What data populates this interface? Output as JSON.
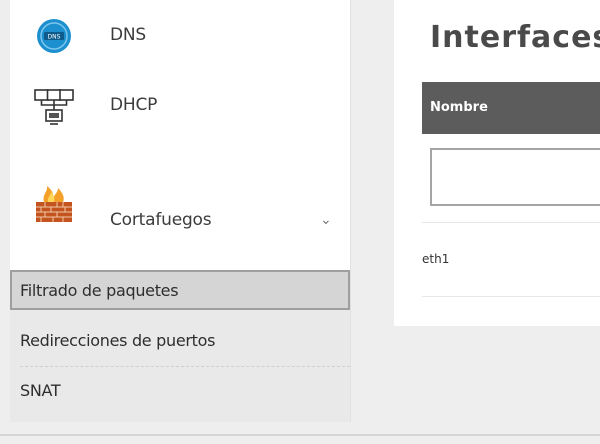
{
  "sidebar": {
    "items": [
      {
        "label": "DNS",
        "icon": "dns-icon"
      },
      {
        "label": "DHCP",
        "icon": "dhcp-network-icon"
      },
      {
        "label": "Cortafuegos",
        "icon": "firewall-icon",
        "expanded": true
      }
    ],
    "submenu": [
      {
        "label": "Filtrado de paquetes",
        "active": true
      },
      {
        "label": "Redirecciones de puertos",
        "active": false
      },
      {
        "label": "SNAT",
        "active": false
      }
    ]
  },
  "main": {
    "title": "Interfaces",
    "table": {
      "columns": [
        "Nombre"
      ],
      "rows": [
        [
          "eth1"
        ]
      ]
    },
    "filter": {
      "value": "",
      "placeholder": ""
    }
  },
  "colors": {
    "header_bg": "#5c5c5c",
    "active_sub_bg": "#d5d5d5",
    "page_bg": "#eeeeee",
    "dns_blue": "#1c8fcf",
    "firewall_orange": "#e8862b",
    "firewall_brick": "#c4541f"
  }
}
